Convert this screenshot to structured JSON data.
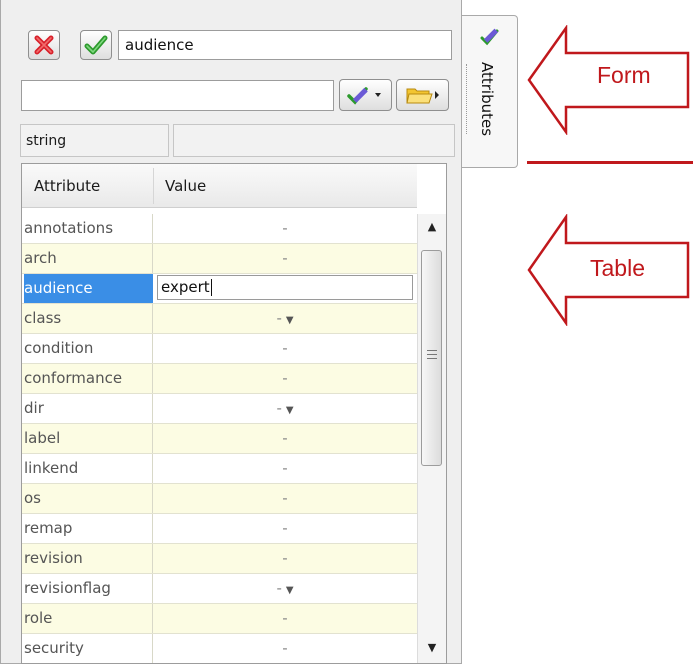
{
  "form": {
    "name_value": "audience",
    "value_input": "",
    "type_label": "string"
  },
  "table": {
    "headers": {
      "attribute": "Attribute",
      "value": "Value"
    },
    "rows": [
      {
        "name": "annotations",
        "value": "-",
        "dropdown": false
      },
      {
        "name": "arch",
        "value": "-",
        "dropdown": false
      },
      {
        "name": "audience",
        "value": "expert",
        "dropdown": false,
        "selected": true
      },
      {
        "name": "class",
        "value": "-",
        "dropdown": true
      },
      {
        "name": "condition",
        "value": "-",
        "dropdown": false
      },
      {
        "name": "conformance",
        "value": "-",
        "dropdown": false
      },
      {
        "name": "dir",
        "value": "-",
        "dropdown": true
      },
      {
        "name": "label",
        "value": "-",
        "dropdown": false
      },
      {
        "name": "linkend",
        "value": "-",
        "dropdown": false
      },
      {
        "name": "os",
        "value": "-",
        "dropdown": false
      },
      {
        "name": "remap",
        "value": "-",
        "dropdown": false
      },
      {
        "name": "revision",
        "value": "-",
        "dropdown": false
      },
      {
        "name": "revisionflag",
        "value": "-",
        "dropdown": true
      },
      {
        "name": "role",
        "value": "-",
        "dropdown": false
      },
      {
        "name": "security",
        "value": "-",
        "dropdown": false
      }
    ]
  },
  "side_tab": {
    "label": "Attributes",
    "icon": "attributes-pencil-icon"
  },
  "annotations": {
    "form": "Form",
    "table": "Table"
  },
  "icons": {
    "cancel": "red-x-icon",
    "accept": "green-check-icon",
    "edit": "pencil-check-dropdown-icon",
    "browse": "folder-arrow-icon"
  },
  "colors": {
    "accent_red": "#c0181c",
    "selected_row": "#3a8ee6",
    "alt_row": "#fcfce3"
  }
}
